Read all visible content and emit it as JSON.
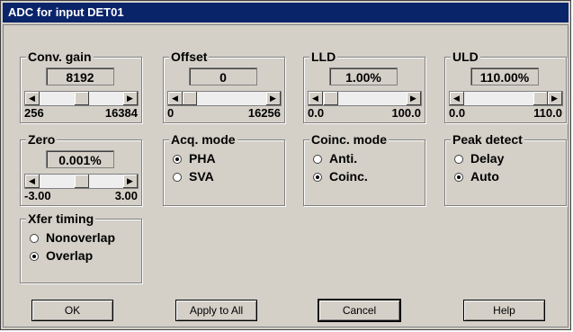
{
  "window": {
    "title": "ADC for input DET01"
  },
  "conv_gain": {
    "title": "Conv. gain",
    "value": "8192",
    "min": "256",
    "max": "16384",
    "position": 0.5
  },
  "offset": {
    "title": "Offset",
    "value": "0",
    "min": "0",
    "max": "16256",
    "position": 0.0
  },
  "lld": {
    "title": "LLD",
    "value": "1.00%",
    "min": "0.0",
    "max": "100.0",
    "position": 0.01
  },
  "uld": {
    "title": "ULD",
    "value": "110.00%",
    "min": "0.0",
    "max": "110.0",
    "position": 1.0
  },
  "zero": {
    "title": "Zero",
    "value": "0.001%",
    "min": "-3.00",
    "max": "3.00",
    "position": 0.5
  },
  "acq_mode": {
    "title": "Acq. mode",
    "options": [
      "PHA",
      "SVA"
    ],
    "selected": "PHA"
  },
  "coinc_mode": {
    "title": "Coinc. mode",
    "options": [
      "Anti.",
      "Coinc."
    ],
    "selected": "Coinc."
  },
  "peak_detect": {
    "title": "Peak detect",
    "options": [
      "Delay",
      "Auto"
    ],
    "selected": "Auto"
  },
  "xfer_timing": {
    "title": "Xfer timing",
    "options": [
      "Nonoverlap",
      "Overlap"
    ],
    "selected": "Overlap"
  },
  "buttons": {
    "ok": "OK",
    "apply_all": "Apply to All",
    "cancel": "Cancel",
    "help": "Help"
  },
  "icons": {
    "scroll_left": "◀",
    "scroll_right": "▶"
  }
}
